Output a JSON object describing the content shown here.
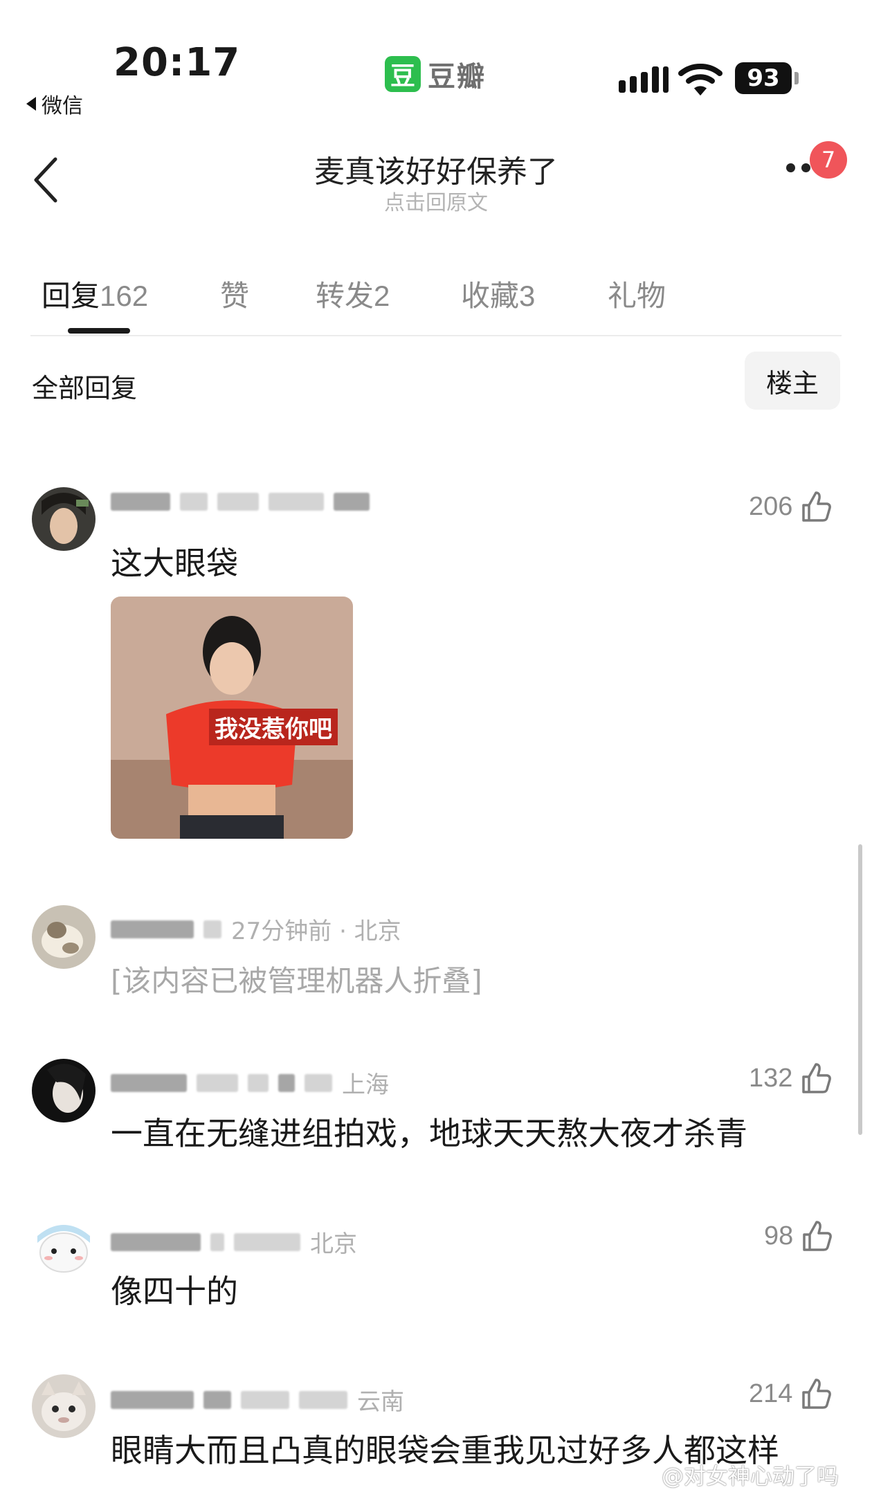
{
  "status_bar": {
    "time": "20:17",
    "back_app": "微信",
    "app_logo_char": "豆",
    "app_name": "豆瓣",
    "battery": "93"
  },
  "header": {
    "title": "麦真该好好保养了",
    "subtitle": "点击回原文",
    "notification_count": "7"
  },
  "tabs": [
    {
      "label": "回复",
      "count": "162",
      "active": true
    },
    {
      "label": "赞",
      "count": ""
    },
    {
      "label": "转发",
      "count": "2"
    },
    {
      "label": "收藏",
      "count": "3"
    },
    {
      "label": "礼物",
      "count": ""
    }
  ],
  "filter": {
    "all_label": "全部回复",
    "owner_button": "楼主"
  },
  "comments": [
    {
      "meta": "",
      "body": "这大眼袋",
      "likes": "206",
      "image_caption": "我没惹你吧"
    },
    {
      "meta": "27分钟前 · 北京",
      "body": "[该内容已被管理机器人折叠]",
      "likes": ""
    },
    {
      "meta": "上海",
      "body": "一直在无缝进组拍戏，地球天天熬大夜才杀青",
      "likes": "132"
    },
    {
      "meta": "北京",
      "body": "像四十的",
      "likes": "98"
    },
    {
      "meta": "云南",
      "body": "眼睛大而且凸真的眼袋会重我见过好多人都这样",
      "likes": "214"
    }
  ],
  "watermark": "@对女神心动了吗",
  "colors": {
    "accent_green": "#2dbe4e",
    "badge_red": "#f0555a",
    "muted_text": "#b0b0b0"
  },
  "icons": [
    "back-chevron-icon",
    "more-dots-icon",
    "thumb-up-icon",
    "wifi-icon",
    "signal-icon",
    "battery-icon"
  ]
}
